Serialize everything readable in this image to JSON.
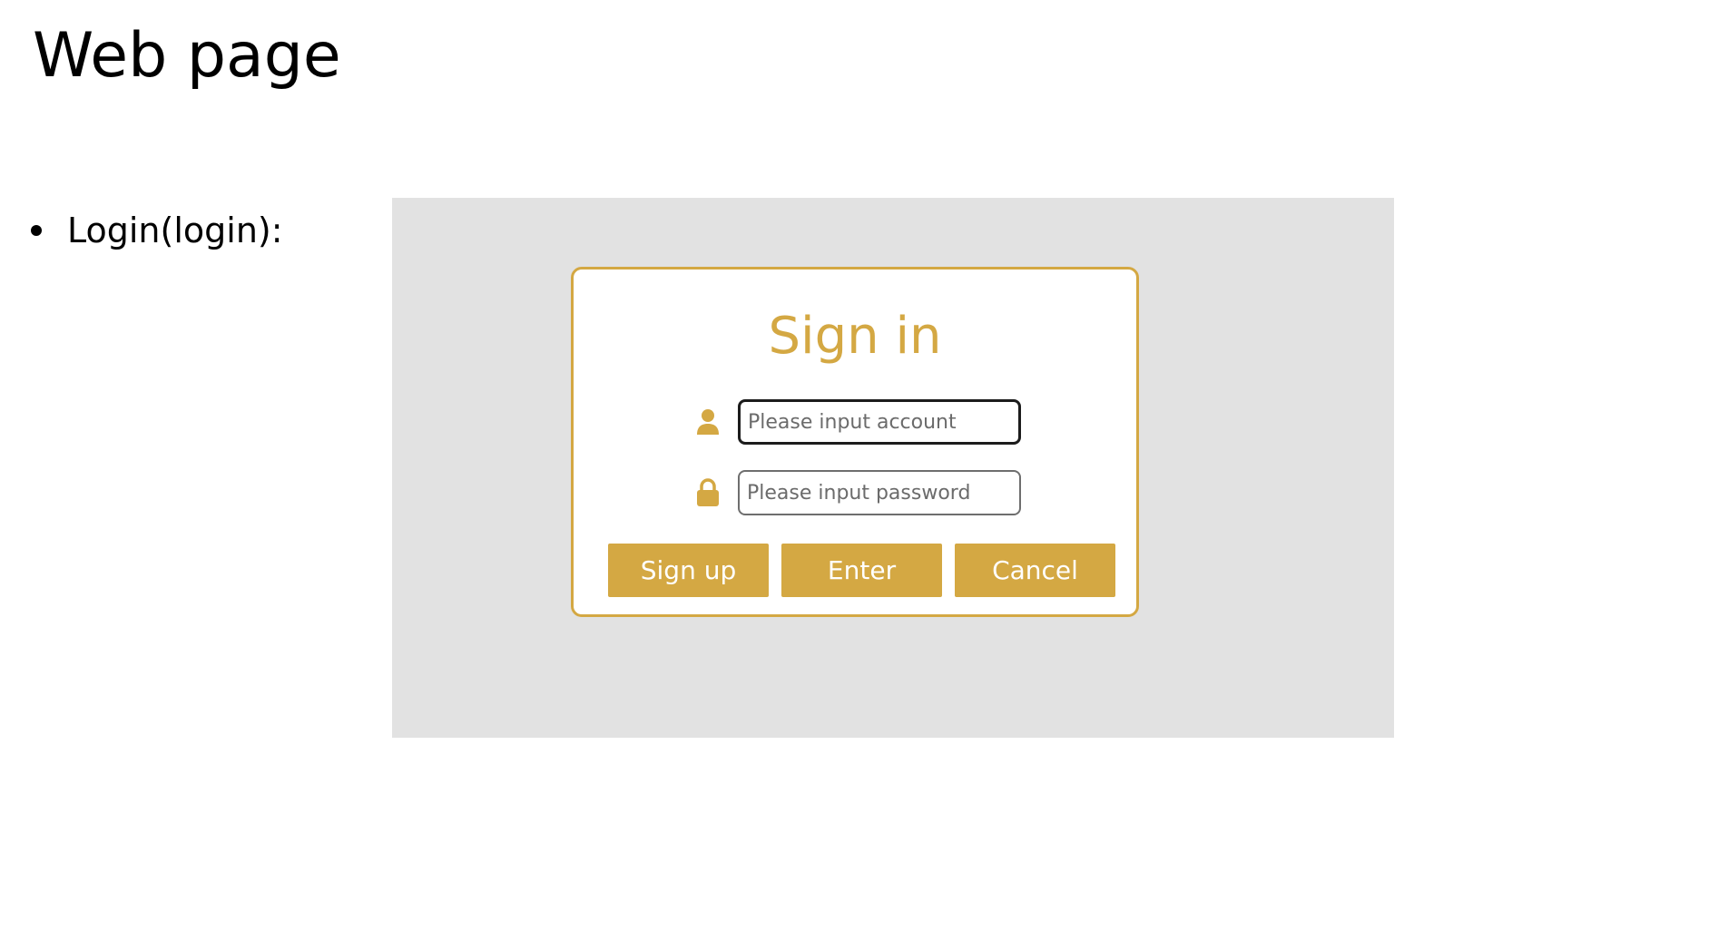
{
  "slide": {
    "title": "Web page",
    "bullet": "Login(login):"
  },
  "login_form": {
    "title": "Sign in",
    "account": {
      "icon": "user-icon",
      "placeholder": "Please input account"
    },
    "password": {
      "icon": "lock-icon",
      "placeholder": "Please input password"
    },
    "buttons": {
      "signup_label": "Sign up",
      "enter_label": "Enter",
      "cancel_label": "Cancel"
    }
  },
  "colors": {
    "accent": "#d4a843",
    "preview_background": "#e2e2e2",
    "slide_background": "#ffffff"
  }
}
